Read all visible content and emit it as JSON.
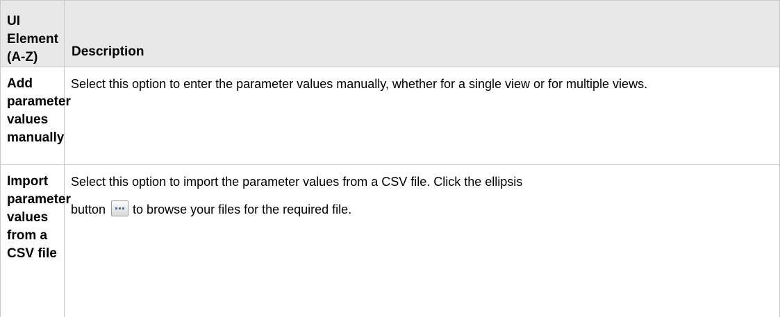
{
  "table": {
    "headers": {
      "element": "UI Element (A-Z)",
      "description": "Description"
    },
    "rows": [
      {
        "name": "Add parameter values manually",
        "description": "Select this option to enter the parameter values manually, whether for a single view or for multiple views."
      },
      {
        "name": "Import parameter values from a CSV file",
        "description_line1": "Select this option to import the parameter values from a CSV file. Click the ellipsis",
        "description_before_icon": "button",
        "description_after_icon": "to browse your files for the required file.",
        "icon": "ellipsis-button-icon"
      }
    ]
  },
  "colors": {
    "header_background": "#e8e8e8",
    "border": "#c8c8c8",
    "icon_dots": "#3d6fb0"
  }
}
